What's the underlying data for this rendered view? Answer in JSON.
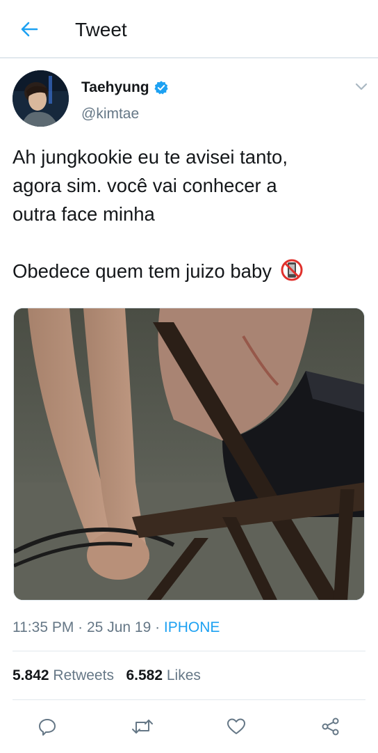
{
  "header": {
    "title": "Tweet",
    "back_icon": "arrow-left-icon",
    "accent_color": "#1da1f2"
  },
  "author": {
    "name": "Taehyung",
    "handle": "@kimtae",
    "verified": true,
    "verified_icon": "verified-badge-icon"
  },
  "tweet": {
    "lines": [
      "Ah jungkookie eu te avisei tanto,",
      "agora sim. você vai conhecer a",
      "outra face minha"
    ],
    "second_paragraph": "Obedece quem tem juizo baby",
    "emoji": "no-mobile-phones-emoji",
    "media_icon": "photo"
  },
  "meta": {
    "time": "11:35 PM",
    "separator": " · ",
    "date": "25 Jun 19",
    "source": "IPHONE"
  },
  "stats": {
    "retweets_count": "5.842",
    "retweets_label": "Retweets",
    "likes_count": "6.582",
    "likes_label": "Likes"
  },
  "actions": {
    "reply_icon": "reply-icon",
    "retweet_icon": "retweet-icon",
    "like_icon": "heart-icon",
    "share_icon": "share-icon",
    "icon_color": "#657786"
  }
}
